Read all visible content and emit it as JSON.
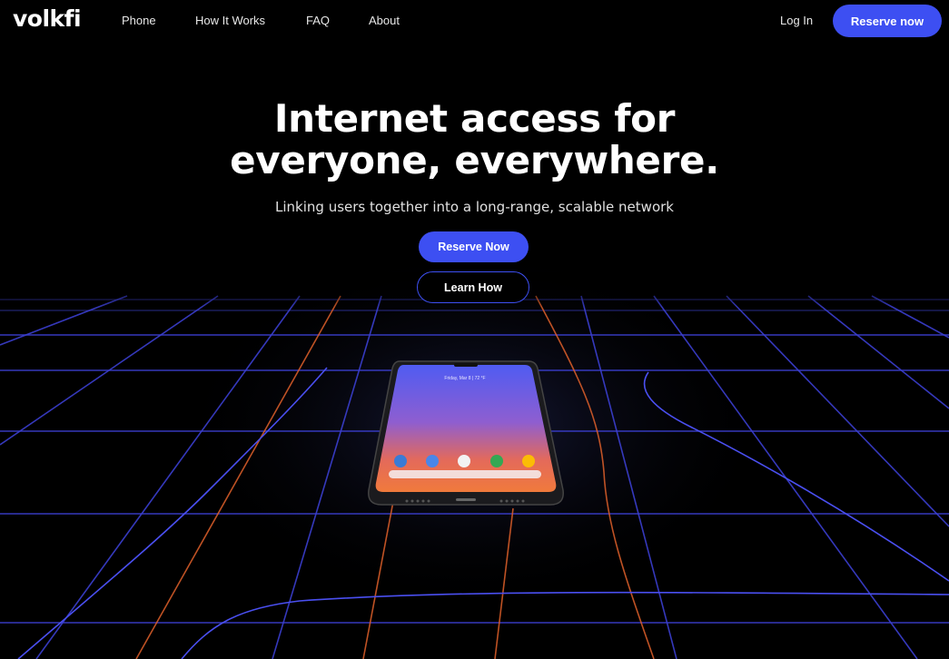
{
  "nav": {
    "logo": "volkfi",
    "links": [
      "Phone",
      "How It Works",
      "FAQ",
      "About"
    ],
    "login": "Log In",
    "reserve": "Reserve now"
  },
  "hero": {
    "title_line1": "Internet access for",
    "title_line2": "everyone, everywhere.",
    "subtitle": "Linking users together into a long-range, scalable network",
    "primary_button": "Reserve Now",
    "secondary_button": "Learn How"
  },
  "phone_screen": {
    "status_text": "Friday, Mar 8 | 72 °F"
  },
  "colors": {
    "accent": "#3d4ff2",
    "background": "#000000"
  }
}
